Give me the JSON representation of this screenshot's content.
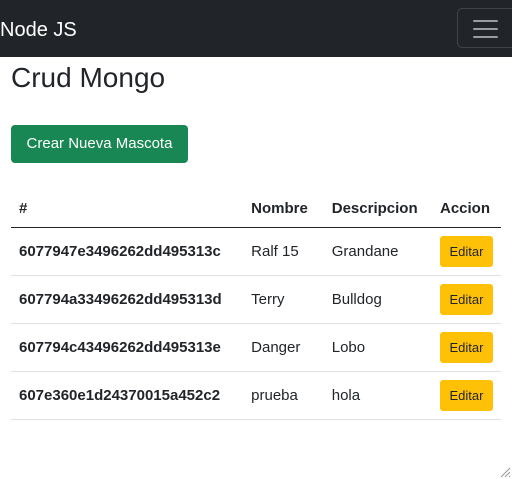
{
  "navbar": {
    "brand": "Node JS",
    "toggler_icon": "hamburger-icon"
  },
  "page": {
    "title": "Crud Mongo",
    "create_button_label": "Crear Nueva Mascota"
  },
  "table": {
    "headers": [
      "#",
      "Nombre",
      "Descripcion",
      "Accion"
    ],
    "rows": [
      {
        "id": "6077947e3496262dd495313c",
        "nombre": "Ralf 15",
        "descripcion": "Grandane",
        "accion": "Editar"
      },
      {
        "id": "607794a33496262dd495313d",
        "nombre": "Terry",
        "descripcion": "Bulldog",
        "accion": "Editar"
      },
      {
        "id": "607794c43496262dd495313e",
        "nombre": "Danger",
        "descripcion": "Lobo",
        "accion": "Editar"
      },
      {
        "id": "607e360e1d24370015a452c2",
        "nombre": "prueba",
        "descripcion": "hola",
        "accion": "Editar"
      }
    ]
  },
  "colors": {
    "navbar_bg": "#212529",
    "create_button_bg": "#198754",
    "edit_button_bg": "#ffc107"
  }
}
